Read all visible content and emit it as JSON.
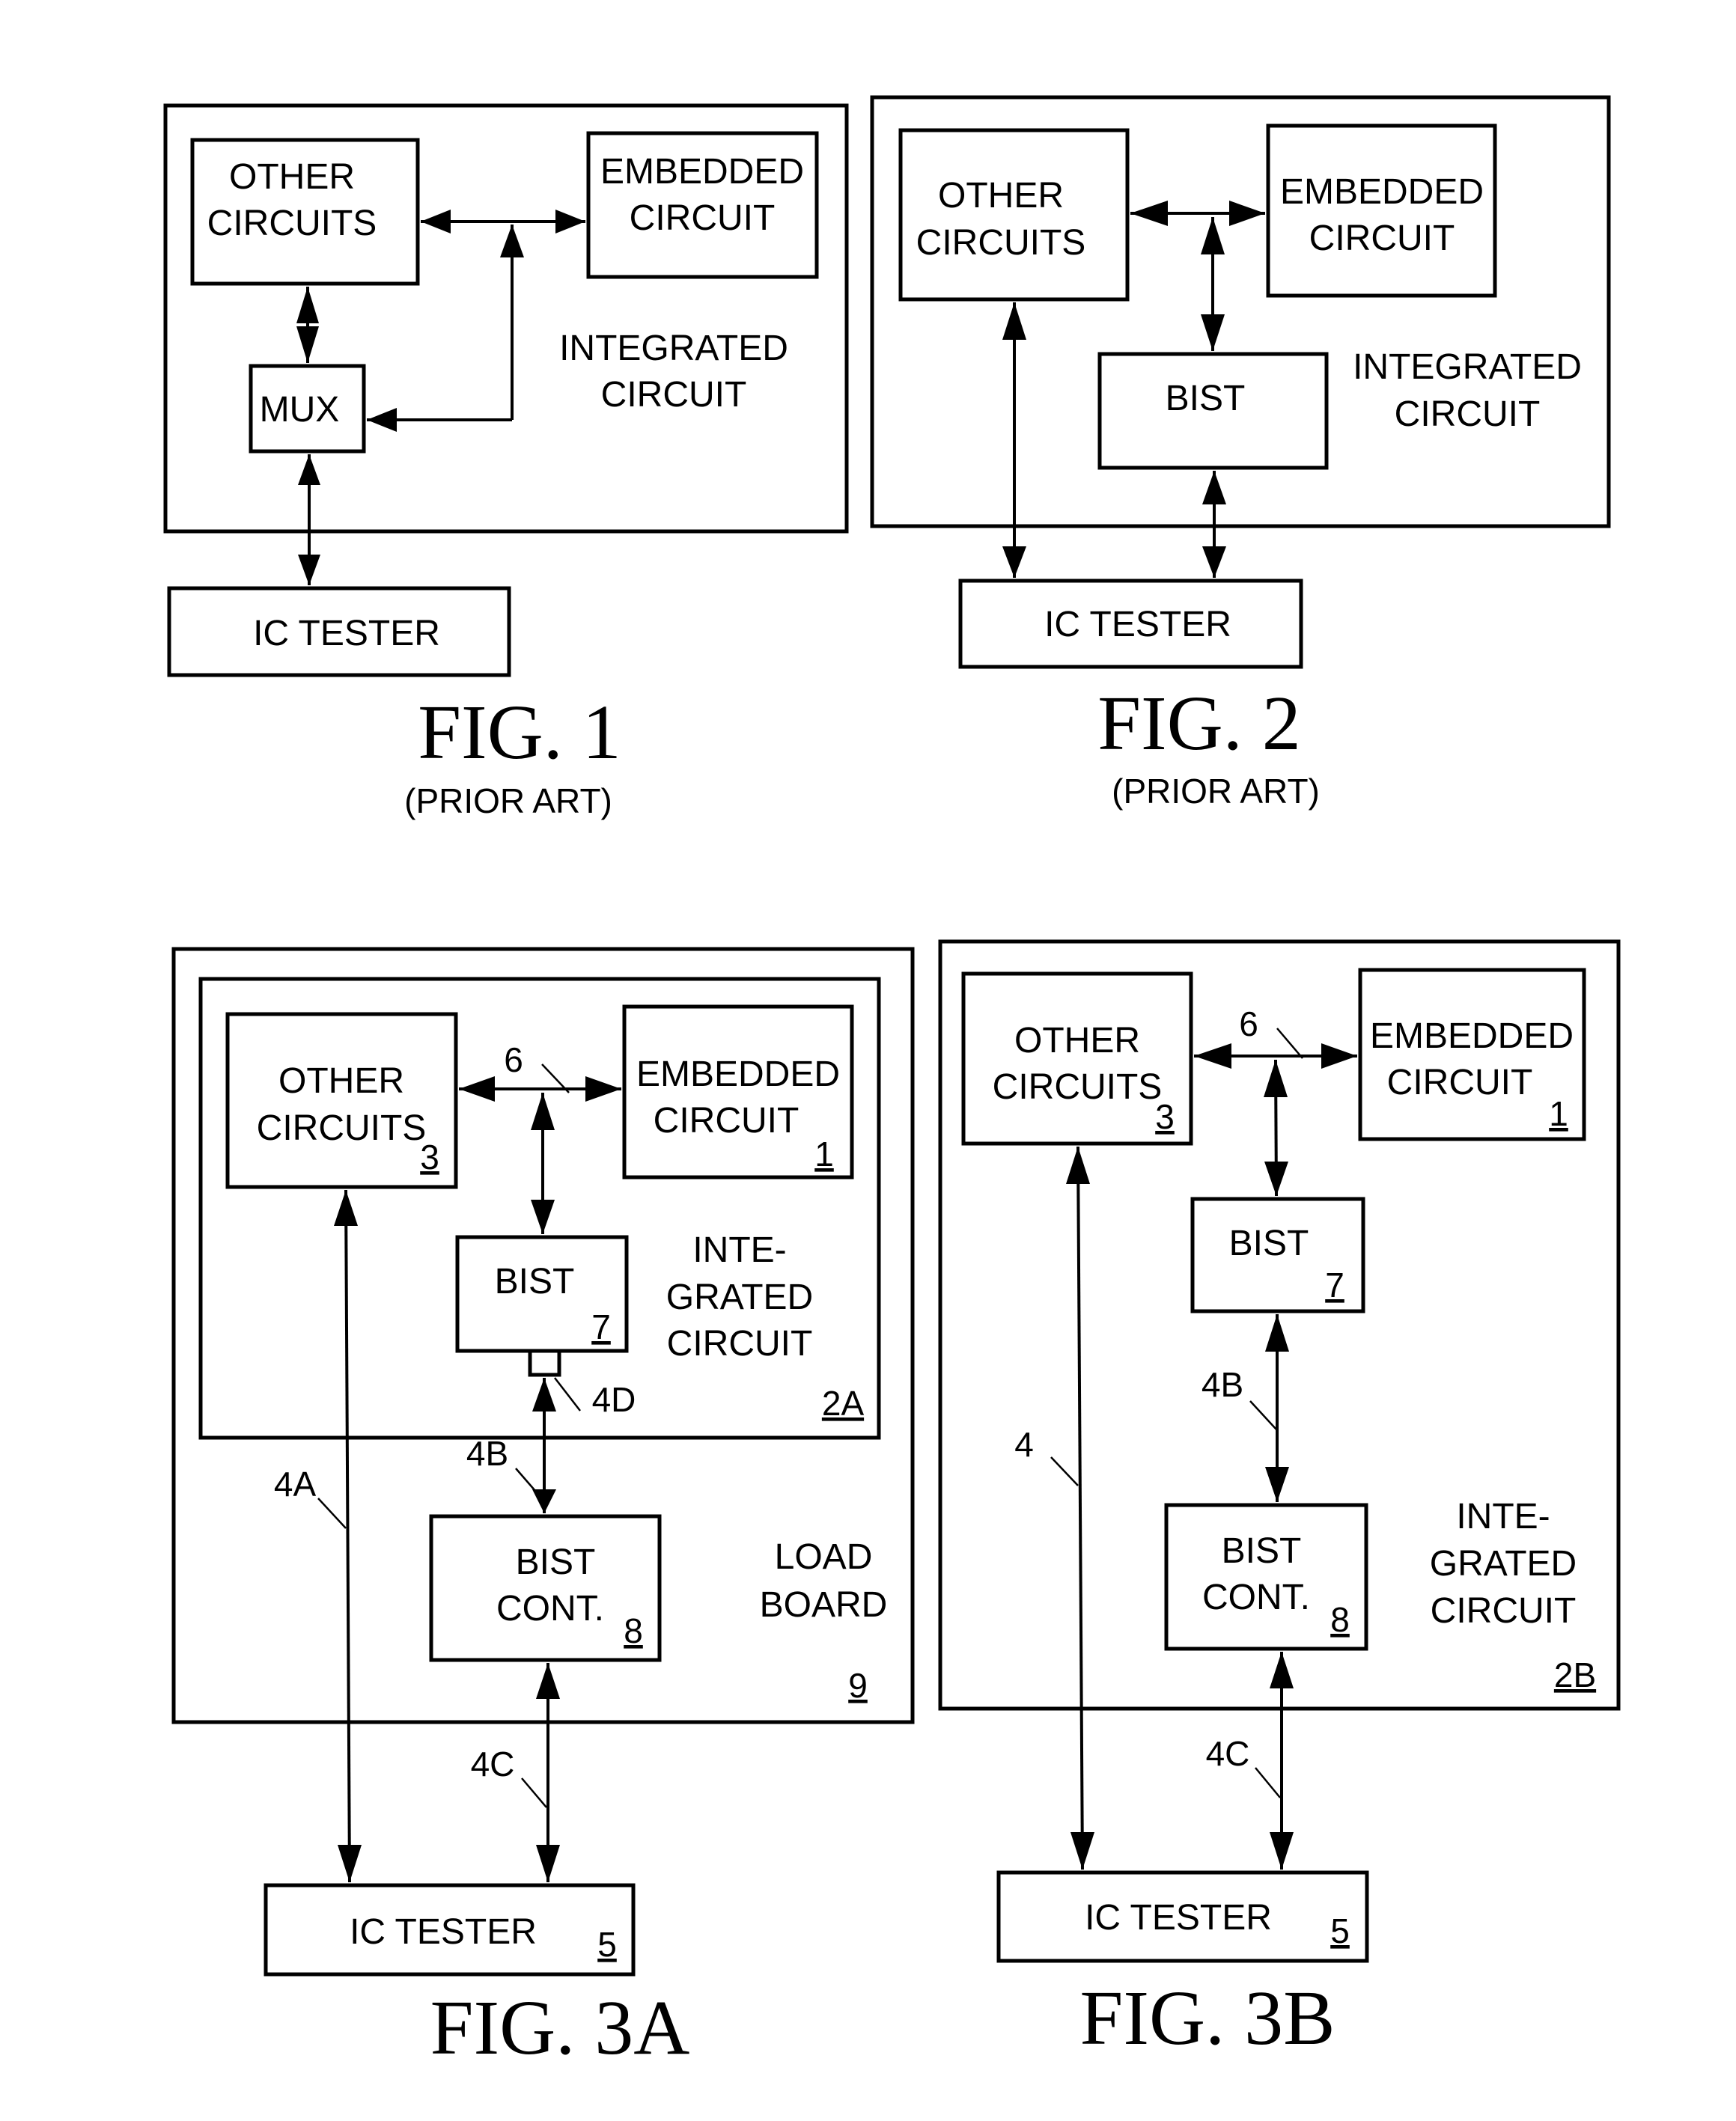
{
  "fig1": {
    "title": "FIG. 1",
    "subtitle": "(PRIOR ART)",
    "other_circuits": [
      "OTHER",
      "CIRCUITS"
    ],
    "embedded_circuit": [
      "EMBEDDED",
      "CIRCUIT"
    ],
    "mux": "MUX",
    "integrated_circuit": [
      "INTEGRATED",
      "CIRCUIT"
    ],
    "ic_tester": "IC TESTER"
  },
  "fig2": {
    "title": "FIG. 2",
    "subtitle": "(PRIOR ART)",
    "other_circuits": [
      "OTHER",
      "CIRCUITS"
    ],
    "embedded_circuit": [
      "EMBEDDED",
      "CIRCUIT"
    ],
    "bist": "BIST",
    "integrated_circuit": [
      "INTEGRATED",
      "CIRCUIT"
    ],
    "ic_tester": "IC TESTER"
  },
  "fig3a": {
    "title": "FIG. 3A",
    "other_circuits": [
      "OTHER",
      "CIRCUITS"
    ],
    "other_circuits_ref": "3",
    "embedded_circuit": [
      "EMBEDDED",
      "CIRCUIT"
    ],
    "embedded_circuit_ref": "1",
    "bus_ref": "6",
    "bist": "BIST",
    "bist_ref": "7",
    "integrated_circuit": [
      "INTE-",
      "GRATED",
      "CIRCUIT"
    ],
    "integrated_circuit_ref": "2A",
    "pad_ref": "4D",
    "link_4b": "4B",
    "link_4a": "4A",
    "link_4c": "4C",
    "bist_cont": [
      "BIST",
      "CONT."
    ],
    "bist_cont_ref": "8",
    "load_board": [
      "LOAD",
      "BOARD"
    ],
    "load_board_ref": "9",
    "ic_tester": "IC TESTER",
    "ic_tester_ref": "5"
  },
  "fig3b": {
    "title": "FIG. 3B",
    "other_circuits": [
      "OTHER",
      "CIRCUITS"
    ],
    "other_circuits_ref": "3",
    "embedded_circuit": [
      "EMBEDDED",
      "CIRCUIT"
    ],
    "embedded_circuit_ref": "1",
    "bus_ref": "6",
    "bist": "BIST",
    "bist_ref": "7",
    "link_4b": "4B",
    "link_4": "4",
    "link_4c": "4C",
    "bist_cont": [
      "BIST",
      "CONT."
    ],
    "bist_cont_ref": "8",
    "integrated_circuit": [
      "INTE-",
      "GRATED",
      "CIRCUIT"
    ],
    "integrated_circuit_ref": "2B",
    "ic_tester": "IC TESTER",
    "ic_tester_ref": "5"
  }
}
